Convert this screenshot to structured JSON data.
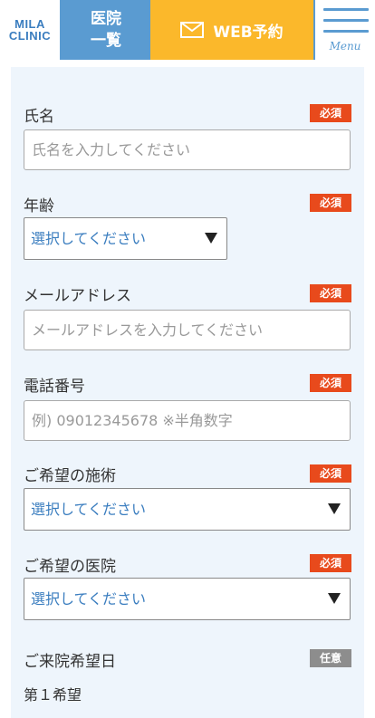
{
  "header": {
    "logo_line1": "MILA",
    "logo_line2": "CLINIC",
    "clinic_list_line1": "医院",
    "clinic_list_line2": "一覧",
    "web_reserve_label": "WEB予約",
    "menu_label": "Menu"
  },
  "colors": {
    "header_blue": "#5a9bd1",
    "reserve_yellow": "#fbb82b",
    "required_badge": "#e84a1c",
    "optional_badge": "#8d8d8d",
    "form_background": "#eef5fc",
    "select_text": "#3a7dbf"
  },
  "icons": {
    "mail": "envelope-icon",
    "menu": "hamburger-icon",
    "dropdown": "triangle-down-icon"
  },
  "form": {
    "name": {
      "label": "氏名",
      "badge": "必須",
      "placeholder": "氏名を入力してください"
    },
    "age": {
      "label": "年齢",
      "badge": "必須",
      "selected": "選択してください"
    },
    "email": {
      "label": "メールアドレス",
      "badge": "必須",
      "placeholder": "メールアドレスを入力してください"
    },
    "phone": {
      "label": "電話番号",
      "badge": "必須",
      "placeholder": "例) 09012345678 ※半角数字"
    },
    "treatment": {
      "label": "ご希望の施術",
      "badge": "必須",
      "selected": "選択してください"
    },
    "clinic": {
      "label": "ご希望の医院",
      "badge": "必須",
      "selected": "選択してください"
    },
    "visit_date": {
      "label": "ご来院希望日",
      "badge": "任意",
      "first_choice_label": "第１希望"
    }
  }
}
